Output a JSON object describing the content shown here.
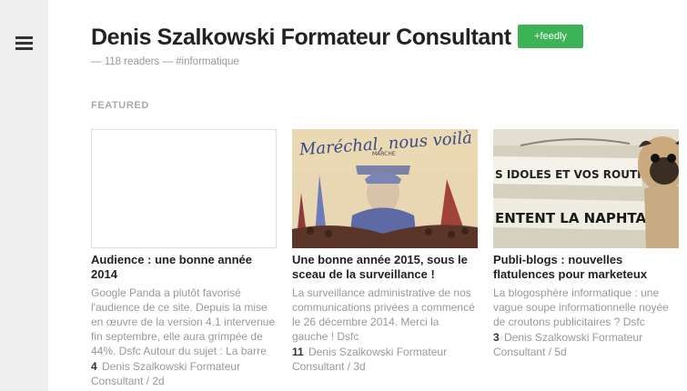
{
  "header": {
    "title": "Denis Szalkowski Formateur Consultant",
    "feedly_label": "+feedly",
    "readers": "118 readers",
    "tag": "#informatique",
    "separator": "—"
  },
  "section_label": "FEATURED",
  "cards": [
    {
      "title": "Audience : une bonne année 2014",
      "summary": "Google Panda a plutôt favorisé l'audience de ce site. Depuis la mise en œuvre de la version 4.1 intervenue fin septembre, elle aura grimpée de 44%. Dsfc Autour du sujet : La barre",
      "count": "4",
      "source": "Denis Szalkowski Formateur Consultant / 2d"
    },
    {
      "title": "Une bonne année 2015, sous le sceau de la surveillance !",
      "summary": "La surveillance administrative de nos communications privées a commencé le 26 décembre 2014. Merci la gauche ! Dsfc",
      "count": "11",
      "source": "Denis Szalkowski Formateur Consultant / 3d",
      "image_text": [
        "Maréchal, nous voilà",
        "MARCHE"
      ]
    },
    {
      "title": "Publi-blogs : nouvelles flatulences pour marketeux",
      "summary": "La blogosphère informatique : une vague soupe informationnelle noyée de croutons publicitaires ? Dsfc",
      "count": "3",
      "source": "Denis Szalkowski Formateur Consultant / 5d",
      "image_text": [
        "S IDOLES ET VOS ROUTINES",
        "ENTENT LA NAPHTALINE"
      ]
    }
  ]
}
